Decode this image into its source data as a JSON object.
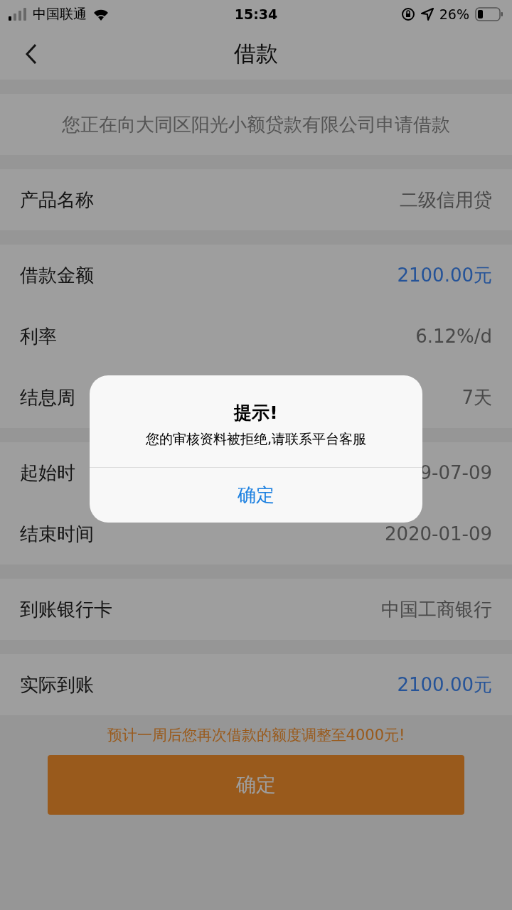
{
  "status_bar": {
    "carrier": "中国联通",
    "time": "15:34",
    "battery_text": "26%"
  },
  "nav": {
    "title": "借款"
  },
  "notice": "您正在向大同区阳光小额贷款有限公司申请借款",
  "groups": [
    {
      "rows": [
        {
          "label": "产品名称",
          "value": "二级信用贷",
          "highlight": false
        }
      ]
    },
    {
      "rows": [
        {
          "label": "借款金额",
          "value": "2100.00元",
          "highlight": true
        },
        {
          "label": "利率",
          "value": "6.12%/d",
          "highlight": false
        },
        {
          "label": "结息周",
          "value": "7天",
          "highlight": false
        }
      ]
    },
    {
      "rows": [
        {
          "label": "起始时",
          "value": "9-07-09",
          "highlight": false
        },
        {
          "label": "结束时间",
          "value": "2020-01-09",
          "highlight": false
        }
      ]
    },
    {
      "rows": [
        {
          "label": "到账银行卡",
          "value": "中国工商银行",
          "highlight": false
        }
      ]
    },
    {
      "rows": [
        {
          "label": "实际到账",
          "value": "2100.00元",
          "highlight": true
        }
      ]
    }
  ],
  "tip": "预计一周后您再次借款的额度调整至4000元!",
  "submit": "确定",
  "dialog": {
    "title": "提示!",
    "message": "您的审核资料被拒绝,请联系平台客服",
    "button": "确定"
  }
}
